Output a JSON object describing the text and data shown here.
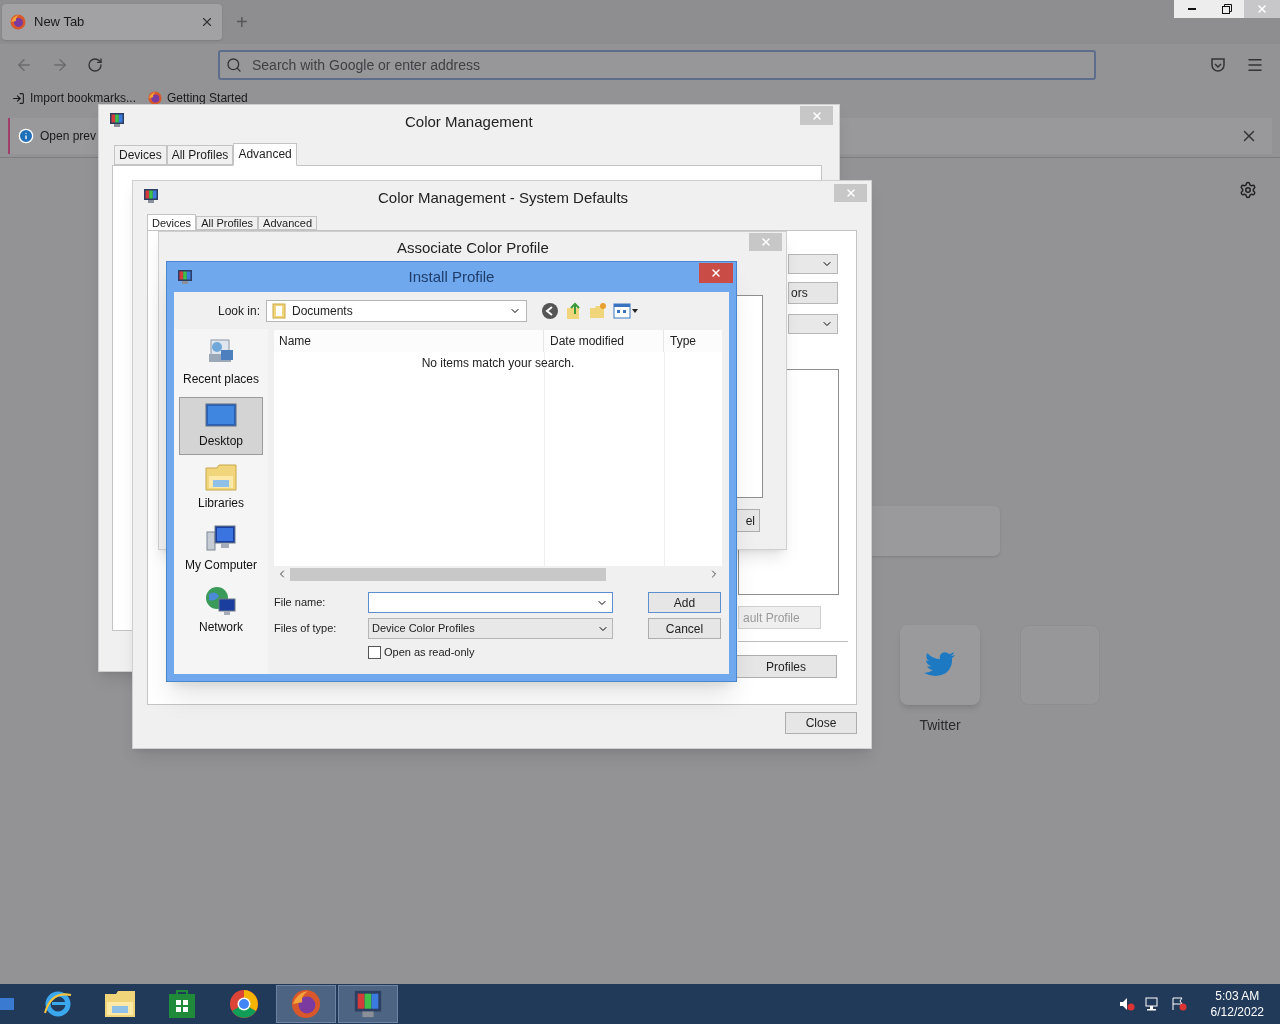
{
  "browser": {
    "tab": {
      "title": "New Tab",
      "new_tab": "+"
    },
    "address": {
      "placeholder": "Search with Google or enter address"
    },
    "bookmarks": [
      {
        "label": "Import bookmarks...",
        "kind": "import"
      },
      {
        "label": "Getting Started",
        "kind": "firefox"
      }
    ],
    "notification": {
      "text": "Open prev"
    },
    "tiles": [
      {
        "label": "Twitter",
        "kind": "twitter"
      },
      {
        "kind": "empty"
      }
    ]
  },
  "color_management": {
    "title": "Color Management",
    "tabs": [
      {
        "label": "Devices",
        "selected": false
      },
      {
        "label": "All Profiles",
        "selected": false
      },
      {
        "label": "Advanced",
        "selected": true
      }
    ]
  },
  "system_defaults": {
    "title": "Color Management - System Defaults",
    "tabs": [
      {
        "label": "Devices",
        "selected": true
      },
      {
        "label": "All Profiles",
        "selected": false
      },
      {
        "label": "Advanced",
        "selected": false
      }
    ],
    "buttons": [
      {
        "label": "ors",
        "disabled": false
      },
      {
        "label": "ault Profile",
        "disabled": true
      },
      {
        "label": "Profiles",
        "disabled": false
      },
      {
        "label": "Close",
        "disabled": false
      }
    ]
  },
  "associate": {
    "title": "Associate Color Profile",
    "buttons": [
      {
        "label": "el"
      }
    ]
  },
  "install_profile": {
    "title": "Install Profile",
    "look_in_label": "Look in:",
    "look_in_value": "Documents",
    "columns": [
      "Name",
      "Date modified",
      "Type"
    ],
    "empty_message": "No items match your search.",
    "places": [
      {
        "label": "Recent places",
        "kind": "recent",
        "selected": false
      },
      {
        "label": "Desktop",
        "kind": "desktop",
        "selected": true
      },
      {
        "label": "Libraries",
        "kind": "libraries",
        "selected": false
      },
      {
        "label": "My Computer",
        "kind": "computer",
        "selected": false
      },
      {
        "label": "Network",
        "kind": "network",
        "selected": false
      }
    ],
    "file_name_label": "File name:",
    "files_of_type_label": "Files of type:",
    "files_of_type_value": "Device Color Profiles",
    "read_only": {
      "label": "Open as read-only",
      "checked": false
    },
    "buttons": [
      "Add",
      "Cancel"
    ]
  },
  "taskbar": {
    "apps": [
      {
        "kind": "ie",
        "selected": false
      },
      {
        "kind": "explorer",
        "selected": false
      },
      {
        "kind": "store",
        "selected": false
      },
      {
        "kind": "chrome",
        "selected": false
      },
      {
        "kind": "firefox",
        "selected": true
      },
      {
        "kind": "colormgmt",
        "selected": true
      }
    ],
    "time": "5:03 AM",
    "date": "6/12/2022"
  }
}
